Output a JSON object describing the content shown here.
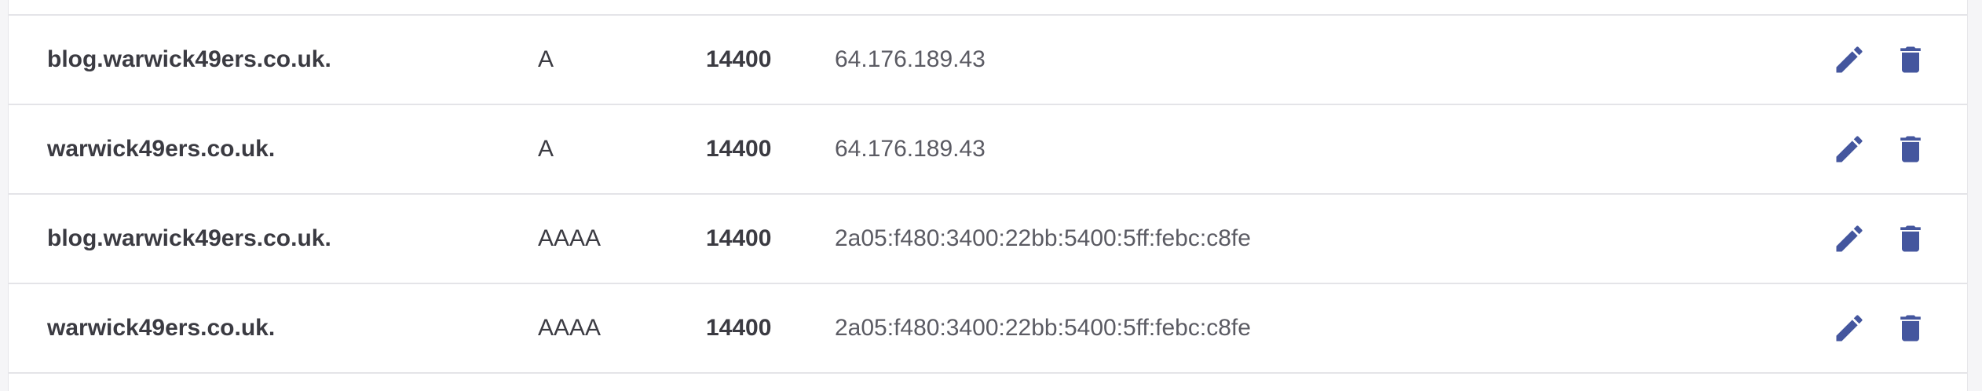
{
  "colors": {
    "icon": "#44569e",
    "divider": "#e4e4e8",
    "text": "#3b3b42",
    "value_text": "#5b5b63"
  },
  "icons": {
    "edit": "pencil-icon",
    "delete": "trash-icon"
  },
  "records": [
    {
      "name": "blog.warwick49ers.co.uk.",
      "type": "A",
      "ttl": "14400",
      "value": "64.176.189.43"
    },
    {
      "name": "warwick49ers.co.uk.",
      "type": "A",
      "ttl": "14400",
      "value": "64.176.189.43"
    },
    {
      "name": "blog.warwick49ers.co.uk.",
      "type": "AAAA",
      "ttl": "14400",
      "value": "2a05:f480:3400:22bb:5400:5ff:febc:c8fe"
    },
    {
      "name": "warwick49ers.co.uk.",
      "type": "AAAA",
      "ttl": "14400",
      "value": "2a05:f480:3400:22bb:5400:5ff:febc:c8fe"
    }
  ]
}
